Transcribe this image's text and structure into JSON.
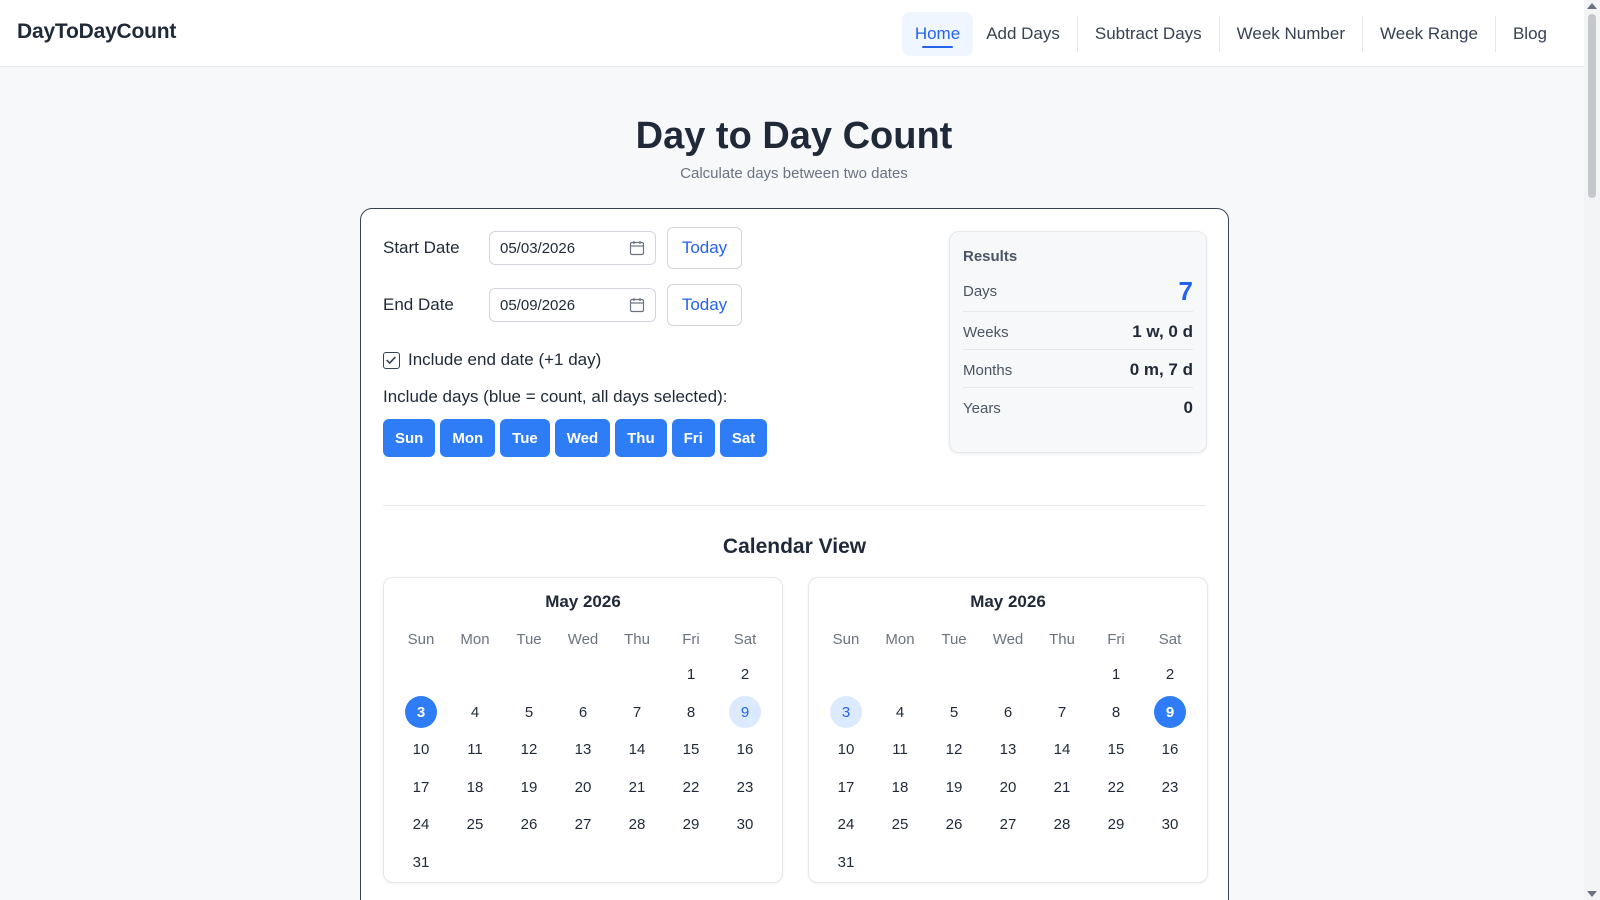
{
  "header": {
    "brand": "DayToDayCount",
    "nav": [
      {
        "label": "Home",
        "active": true
      },
      {
        "label": "Add Days",
        "active": false
      },
      {
        "label": "Subtract Days",
        "active": false
      },
      {
        "label": "Week Number",
        "active": false
      },
      {
        "label": "Week Range",
        "active": false
      },
      {
        "label": "Blog",
        "active": false
      }
    ]
  },
  "page": {
    "title": "Day to Day Count",
    "subtitle": "Calculate days between two dates"
  },
  "form": {
    "start_label": "Start Date",
    "start_value": "05/03/2026",
    "end_label": "End Date",
    "end_value": "05/09/2026",
    "today_label": "Today",
    "include_end_label": "Include end date (+1 day)",
    "include_end_checked": true,
    "include_days_label": "Include days (blue = count, all days selected):",
    "days": [
      "Sun",
      "Mon",
      "Tue",
      "Wed",
      "Thu",
      "Fri",
      "Sat"
    ]
  },
  "results": {
    "title": "Results",
    "rows": [
      {
        "label": "Days",
        "value": "7"
      },
      {
        "label": "Weeks",
        "value": "1 w, 0 d"
      },
      {
        "label": "Months",
        "value": "0 m, 7 d"
      },
      {
        "label": "Years",
        "value": "0"
      }
    ]
  },
  "calendar": {
    "title": "Calendar View",
    "weekday_headers": [
      "Sun",
      "Mon",
      "Tue",
      "Wed",
      "Thu",
      "Fri",
      "Sat"
    ],
    "months": [
      {
        "title": "May 2026",
        "first_weekday": 5,
        "days_in_month": 31,
        "selected": 3,
        "range_end": 9
      },
      {
        "title": "May 2026",
        "first_weekday": 5,
        "days_in_month": 31,
        "selected": 9,
        "range_end": 3
      }
    ]
  },
  "colors": {
    "accent": "#2563eb",
    "chip": "#2f7df6",
    "range_highlight": "#dbeafe"
  }
}
